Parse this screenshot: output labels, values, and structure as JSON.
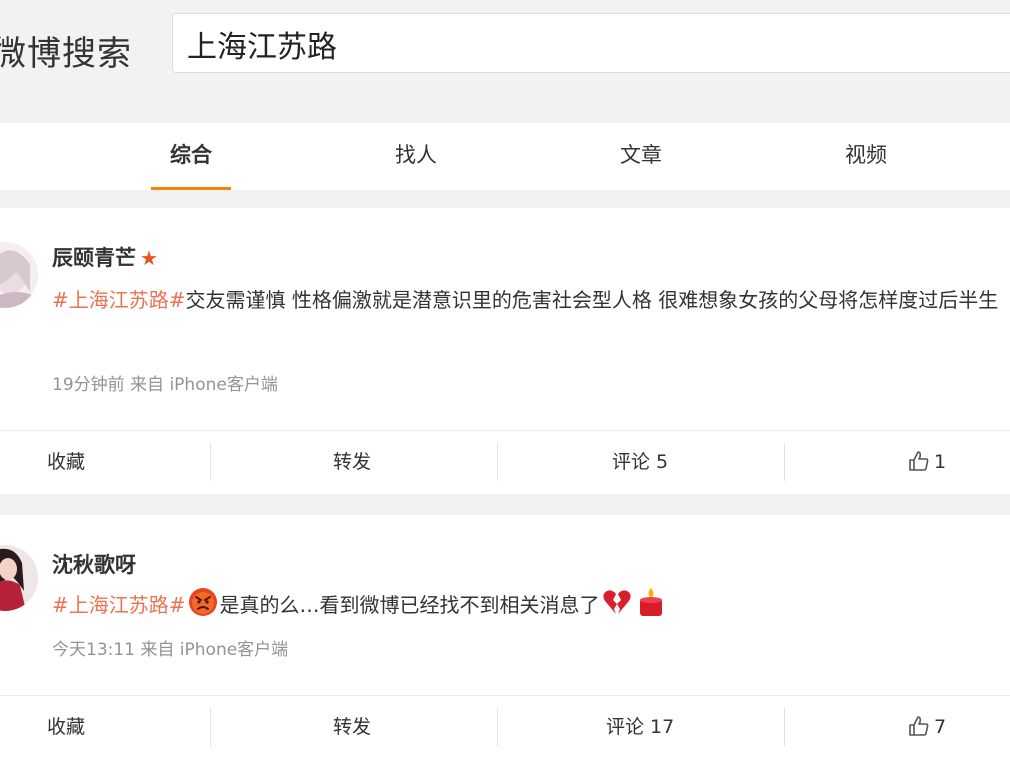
{
  "header": {
    "brand": "微博搜索",
    "search_value": "上海江苏路"
  },
  "tabs": [
    {
      "label": "综合",
      "active": true
    },
    {
      "label": "找人",
      "active": false
    },
    {
      "label": "文章",
      "active": false
    },
    {
      "label": "视频",
      "active": false
    }
  ],
  "accent_color": "#ff8200",
  "hashtag_color": "#eb7350",
  "posts": [
    {
      "username": "辰颐青芒",
      "badge_icon": "star-icon",
      "hashtag": "#上海江苏路#",
      "text": "交友需谨慎 性格偏激就是潜意识里的危害社会型人格 很难想象女孩的父母将怎样度过后半生",
      "meta": "19分钟前 来自 iPhone客户端",
      "actions": {
        "favorite": "收藏",
        "repost": "转发",
        "comment": "评论 5",
        "like_count": "1"
      }
    },
    {
      "username": "沈秋歌呀",
      "hashtag": "#上海江苏路#",
      "emoji_before": "angry-face-icon",
      "text": "是真的么…看到微博已经找不到相关消息了",
      "emoji_after": [
        "broken-heart-icon",
        "candle-icon"
      ],
      "meta": "今天13:11 来自 iPhone客户端",
      "actions": {
        "favorite": "收藏",
        "repost": "转发",
        "comment": "评论 17",
        "like_count": "7"
      }
    }
  ]
}
